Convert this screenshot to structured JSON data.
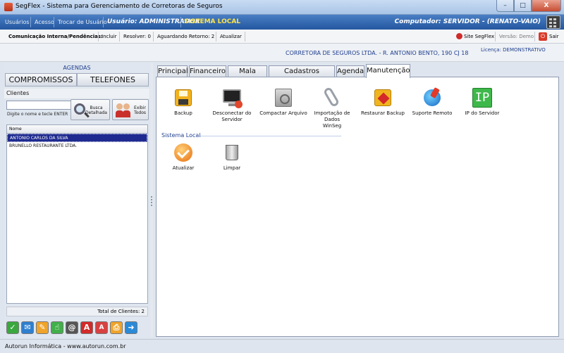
{
  "window": {
    "title": "SegFlex - Sistema para Gerenciamento de Corretoras de Seguros",
    "minimize": "–",
    "maximize": "□",
    "close": "X"
  },
  "menubar": {
    "items": [
      "Usuários",
      "Acesso",
      "Trocar de Usuário"
    ],
    "user": "Usuário: ADMINISTRADOR",
    "local": "SISTEMA LOCAL",
    "computer": "Computador: SERVIDOR - (RENATO-VAIO)"
  },
  "toolbar": {
    "comm_label": "Comunicação Interna/Pendências:",
    "include": "Incluir",
    "resolve": "Resolver: 0",
    "awaiting": "Aguardando Retorno: 2",
    "update": "Atualizar",
    "site": "Site SegFlex",
    "version": "Versão: Demo",
    "exit": "Sair"
  },
  "company": {
    "name": "CORRETORA DE SEGUROS LTDA. - R. ANTONIO BENTO, 190 CJ 18",
    "license": "Licença: DEMONSTRATIVO"
  },
  "left": {
    "agendas_title": "AGENDAS",
    "compromissos": "COMPROMISSOS",
    "telefones": "TELEFONES",
    "clients_title": "Clientes",
    "search_value": "",
    "search_hint": "Digite o nome e tecle ENTER",
    "busca_line1": "Busca",
    "busca_line2": "Detalhada",
    "exibir_line1": "Exibir",
    "exibir_line2": "Todos",
    "list_header": "Nome",
    "clients": [
      "ANTONIO CARLOS DA SILVA",
      "BRUNELLO RESTAURANTE LTDA."
    ],
    "total": "Total de Clientes: 2",
    "bottom_icons": [
      "check-icon",
      "email-icon",
      "note-icon",
      "hand-icon",
      "at-icon",
      "pdf-icon",
      "pdf-small-icon",
      "print-icon",
      "next-icon"
    ]
  },
  "tabs": [
    "Principal",
    "Financeiro",
    "Mala Direta",
    "Cadastros Auxiliares",
    "Agenda",
    "Manutenção"
  ],
  "tools": [
    {
      "label1": "Backup",
      "label2": ""
    },
    {
      "label1": "Desconectar do",
      "label2": "Servidor"
    },
    {
      "label1": "Compactar Arquivo",
      "label2": ""
    },
    {
      "label1": "Importação de Dados",
      "label2": "WinSeg"
    },
    {
      "label1": "Restaurar Backup",
      "label2": ""
    },
    {
      "label1": "Suporte Remoto",
      "label2": ""
    },
    {
      "label1": "IP do Servidor",
      "label2": ""
    }
  ],
  "local_section": {
    "title": "Sistema Local",
    "tools": [
      {
        "label": "Atualizar"
      },
      {
        "label": "Limpar"
      }
    ]
  },
  "ip_text": "IP",
  "status_text": "Autorun Informática - www.autorun.com.br",
  "colors": {
    "menubar": "#23569f",
    "accent_text": "#1d3d8f",
    "local_yellow": "#ffe54a",
    "selected_row": "#1e2a8f"
  }
}
